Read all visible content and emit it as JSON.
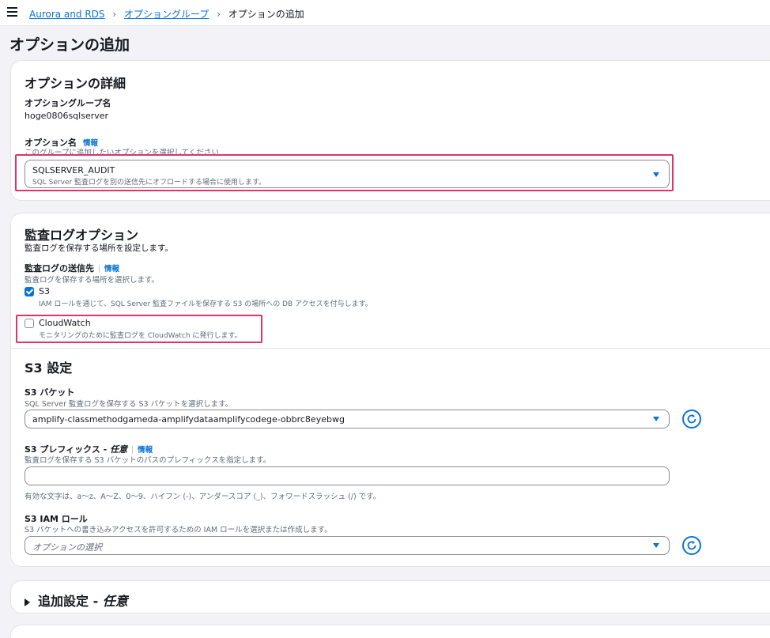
{
  "breadcrumb": {
    "items": [
      "Aurora and RDS",
      "オプショングループ"
    ],
    "current": "オプションの追加"
  },
  "page_title": "オプションの追加",
  "option_details": {
    "header": "オプションの詳細",
    "group_name_label": "オプショングループ名",
    "group_name_value": "hoge0806sqlserver",
    "option_name_label": "オプション名",
    "info": "情報",
    "option_name_desc": "このグループに追加したいオプションを選択してください",
    "selected_option": "SQLSERVER_AUDIT",
    "selected_option_desc": "SQL Server 監査ログを別の送信先にオフロードする場合に使用します。"
  },
  "audit_options": {
    "header": "監査ログオプション",
    "desc": "監査ログを保存する場所を設定します。",
    "destination_label": "監査ログの送信先",
    "info": "情報",
    "destination_desc": "監査ログを保存する場所を選択します。",
    "s3_label": "S3",
    "s3_desc": "IAM ロールを通じて、SQL Server 監査ファイルを保存する S3 の場所への DB アクセスを付与します。",
    "s3_checked": true,
    "cloudwatch_label": "CloudWatch",
    "cloudwatch_desc": "モニタリングのために監査ログを CloudWatch に発行します。",
    "cloudwatch_checked": false
  },
  "s3_settings": {
    "header": "S3 設定",
    "bucket_label": "S3 バケット",
    "bucket_desc": "SQL Server 監査ログを保存する S3 バケットを選択します。",
    "bucket_value": "amplify-classmethodgameda-amplifydataamplifycodege-obbrc8eyebwg",
    "prefix_label": "S3 プレフィックス - ",
    "prefix_label_optional": "任意",
    "info": "情報",
    "prefix_desc": "監査ログを保存する S3 バケットのパスのプレフィックスを指定します。",
    "prefix_value": "",
    "prefix_hint": "有効な文字は、a〜z、A〜Z、0〜9、ハイフン (-)、アンダースコア (_)、フォワードスラッシュ (/) です。",
    "iam_label": "S3 IAM ロール",
    "iam_desc": "S3 バケットへの書き込みアクセスを許可するための IAM ロールを選択または作成します。",
    "iam_placeholder": "オプションの選択"
  },
  "additional": {
    "label": "追加設定 - ",
    "label_optional": "任意"
  },
  "colors": {
    "link": "#0972d3",
    "highlight": "#e0336d",
    "background": "#f3f3f7"
  }
}
